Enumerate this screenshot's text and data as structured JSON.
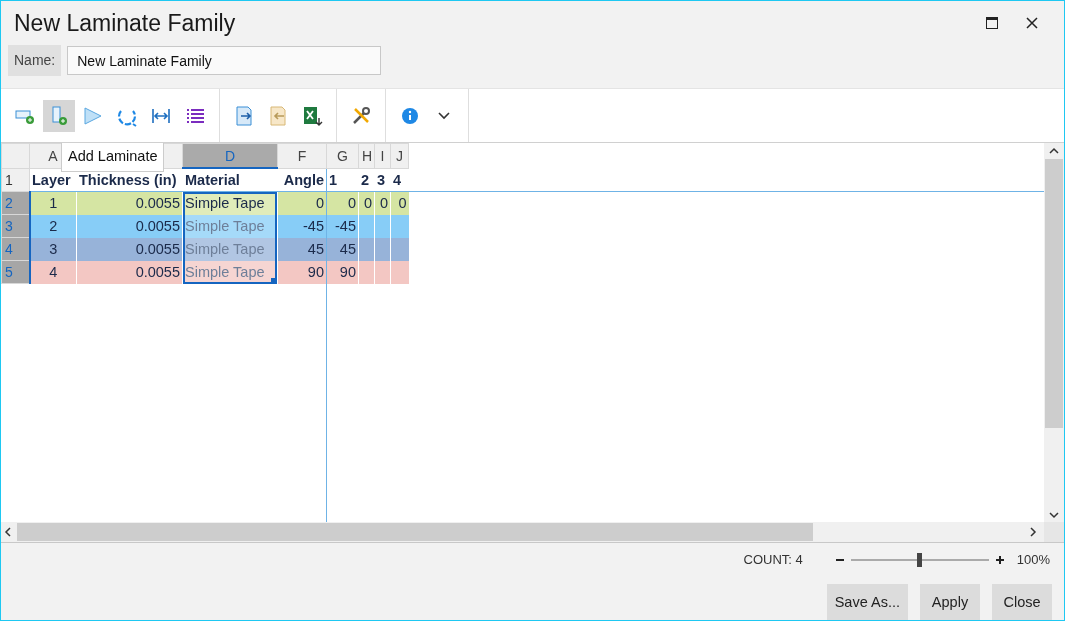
{
  "window": {
    "title": "New Laminate Family"
  },
  "name_field": {
    "label": "Name:",
    "value": "New Laminate Family"
  },
  "toolbar": {
    "groups": [
      [
        {
          "kind": "add-row",
          "pressed": false
        },
        {
          "kind": "add-laminate",
          "pressed": true
        },
        {
          "kind": "triangle",
          "pressed": false
        },
        {
          "kind": "refresh",
          "pressed": false
        },
        {
          "kind": "width",
          "pressed": false
        },
        {
          "kind": "list",
          "pressed": false
        }
      ],
      [
        {
          "kind": "import",
          "pressed": false
        },
        {
          "kind": "export",
          "pressed": false
        },
        {
          "kind": "excel",
          "pressed": false
        }
      ],
      [
        {
          "kind": "wrench",
          "pressed": false
        }
      ],
      [
        {
          "kind": "info",
          "pressed": false
        },
        {
          "kind": "chevron",
          "pressed": false
        }
      ]
    ]
  },
  "tooltip": {
    "text": "Add Laminate"
  },
  "grid": {
    "columns": [
      {
        "letter": "A",
        "selected": false
      },
      {
        "selected": false
      },
      {
        "letter": "D",
        "selected": true
      },
      {
        "letter": "F",
        "selected": false
      },
      {
        "letter": "G",
        "selected": false
      },
      {
        "letter": "H",
        "selected": false
      },
      {
        "letter": "I",
        "selected": false
      },
      {
        "letter": "J",
        "selected": false
      }
    ],
    "header_row": {
      "number": "1",
      "cells": [
        "Layer",
        "Thickness (in)",
        "Material",
        "Angle",
        "1",
        "2",
        "3",
        "4"
      ]
    },
    "rows": [
      {
        "number": "2",
        "selected": true,
        "color": "#d5e5a3",
        "material_dimmed": false,
        "cells": [
          "1",
          "0.0055",
          "Simple Tape",
          "0",
          "0",
          "0",
          "0",
          "0"
        ]
      },
      {
        "number": "3",
        "selected": true,
        "color": "#87cdf7",
        "material_dimmed": true,
        "cells": [
          "2",
          "0.0055",
          "Simple Tape",
          "-45",
          "-45",
          null,
          null,
          null
        ]
      },
      {
        "number": "4",
        "selected": true,
        "color": "#97b3d9",
        "material_dimmed": true,
        "cells": [
          "3",
          "0.0055",
          "Simple Tape",
          "45",
          "45",
          null,
          null,
          null
        ]
      },
      {
        "number": "5",
        "selected": true,
        "color": "#f3c7c3",
        "material_dimmed": true,
        "cells": [
          "4",
          "0.0055",
          "Simple Tape",
          "90",
          "90",
          null,
          null,
          null
        ]
      }
    ]
  },
  "status_bar": {
    "count": "COUNT: 4",
    "zoom": {
      "level": 0.5,
      "reading": "100%"
    }
  },
  "buttons": [
    "Save As...",
    "Apply",
    "Close"
  ]
}
